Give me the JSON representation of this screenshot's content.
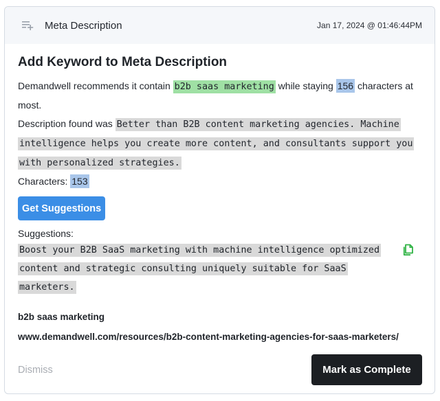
{
  "header": {
    "title": "Meta Description",
    "timestamp": "Jan 17, 2024 @ 01:46:44PM",
    "icon": "add-to-list-icon"
  },
  "content": {
    "heading": "Add Keyword to Meta Description",
    "recommend_prefix": "Demandwell recommends it contain",
    "keyword_highlight": "b2b saas marketing",
    "recommend_middle": "while staying",
    "char_limit": "156",
    "recommend_suffix": "characters at most.",
    "found_prefix": "Description found was",
    "found_description": "Better than B2B content marketing agencies. Machine intelligence helps you create more content, and consultants support you with personalized strategies.",
    "characters_label": "Characters:",
    "characters_count": "153",
    "get_suggestions_label": "Get Suggestions",
    "suggestions_label": "Suggestions:",
    "suggestion_text": "Boost your B2B SaaS marketing with machine intelligence optimized content and strategic consulting uniquely suitable for SaaS marketers.",
    "copy_icon": "copy-icon",
    "target_keyword": "b2b saas marketing",
    "page_url": "www.demandwell.com/resources/b2b-content-marketing-agencies-for-saas-marketers/"
  },
  "footer": {
    "dismiss_label": "Dismiss",
    "complete_label": "Mark as Complete"
  }
}
